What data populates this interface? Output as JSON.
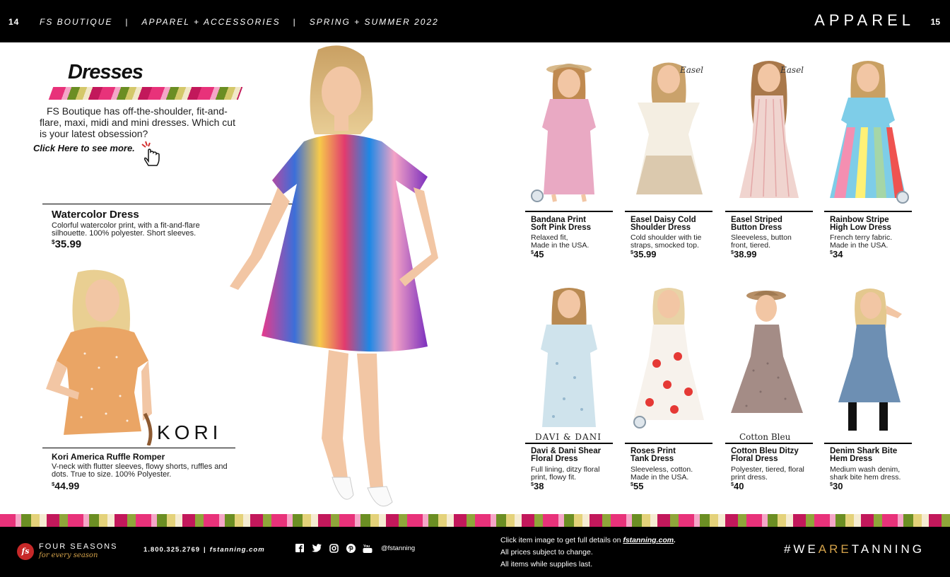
{
  "header": {
    "page_left": "14",
    "crumbs": [
      "FS BOUTIQUE",
      "APPAREL + ACCESSORIES",
      "SPRING + SUMMER 2022"
    ],
    "separator": "|",
    "section": "APPAREL",
    "page_right": "15"
  },
  "intro": {
    "title": "Dresses",
    "body": "FS Boutique has off-the-shoulder, fit-and-flare, maxi, midi and mini dresses. Which cut is your latest obsession?",
    "link": "Click Here to see more."
  },
  "featured": {
    "name": "Watercolor Dress",
    "description": "Colorful watercolor print, with a fit-and-flare silhouette. 100% polyester. Short sleeves.",
    "currency": "$",
    "price": "35.99"
  },
  "romper": {
    "brand": "KORI",
    "name": "Kori America Ruffle Romper",
    "description": "V-neck with flutter sleeves, flowy shorts, ruffles and dots. True to size. 100% Polyester.",
    "currency": "$",
    "price": "44.99"
  },
  "products": [
    {
      "name_1": "Bandana Print",
      "name_2": "Soft Pink Dress",
      "desc_1": "Relaxed fit,",
      "desc_2": "Made in the USA.",
      "currency": "$",
      "price": "45"
    },
    {
      "name_1": "Easel Daisy Cold",
      "name_2": "Shoulder Dress",
      "desc_1": "Cold shoulder with tie",
      "desc_2": "straps, smocked top.",
      "currency": "$",
      "price": "35.99"
    },
    {
      "name_1": "Easel Striped",
      "name_2": "Button Dress",
      "desc_1": "Sleeveless, button",
      "desc_2": "front, tiered.",
      "currency": "$",
      "price": "38.99"
    },
    {
      "name_1": "Rainbow Stripe",
      "name_2": "High Low Dress",
      "desc_1": "French terry fabric.",
      "desc_2": "Made in the USA.",
      "currency": "$",
      "price": "34"
    },
    {
      "name_1": "Davi & Dani Shear",
      "name_2": "Floral Dress",
      "desc_1": "Full lining, ditzy floral",
      "desc_2": "print, flowy fit.",
      "currency": "$",
      "price": "38"
    },
    {
      "name_1": "Roses Print",
      "name_2": "Tank Dress",
      "desc_1": "Sleeveless, cotton.",
      "desc_2": "Made in the USA.",
      "currency": "$",
      "price": "55"
    },
    {
      "name_1": "Cotton Bleu Ditzy",
      "name_2": "Floral Dress",
      "desc_1": "Polyester, tiered, floral",
      "desc_2": "print dress.",
      "currency": "$",
      "price": "40"
    },
    {
      "name_1": "Denim Shark Bite",
      "name_2": "Hem Dress",
      "desc_1": "Medium wash denim,",
      "desc_2": "shark bite hem dress.",
      "currency": "$",
      "price": "30"
    }
  ],
  "brand_marks": {
    "easel": "Easel",
    "davi_dani": "DAVI & DANI",
    "cotton_bleu": "Cotton Bleu"
  },
  "footer": {
    "logo_mark": "fs",
    "company": "FOUR SEASONS",
    "tagline": "for every season",
    "phone": "1.800.325.2769",
    "bar": "|",
    "website": "fstanning.com",
    "social_handle": "@fstanning",
    "notes": [
      "Click item image to get full details on ",
      "All prices subject to change.",
      "All items while supplies last."
    ],
    "notes_site": "fstanning.com",
    "notes_end": ".",
    "hashtag_1": "#WE",
    "hashtag_2": "ARE",
    "hashtag_3": "TANNING"
  },
  "colors": {
    "accent_gold": "#d4a24a",
    "brand_red": "#c62828"
  }
}
